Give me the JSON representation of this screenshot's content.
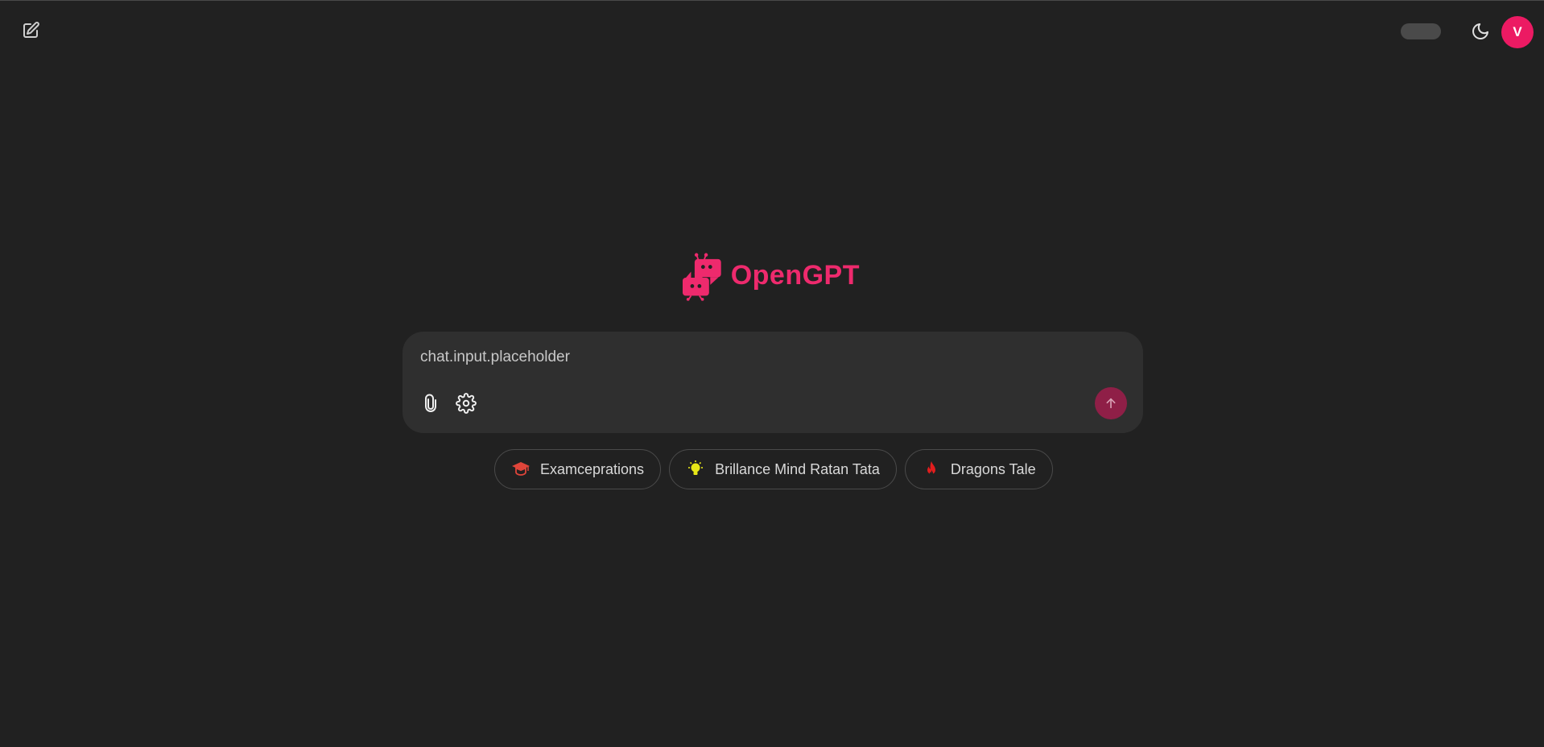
{
  "header": {
    "new_chat_icon": "edit-icon",
    "theme_icon": "moon-icon",
    "avatar_initial": "V",
    "avatar_color": "#ec1a63"
  },
  "logo": {
    "text": "OpenGPT",
    "color": "#ee2a6d",
    "icon": "robots-logo-icon"
  },
  "chat": {
    "placeholder": "chat.input.placeholder",
    "attach_icon": "paperclip-icon",
    "settings_icon": "gear-icon",
    "send_icon": "arrow-up-icon",
    "send_color": "#8f1f47"
  },
  "suggestions": [
    {
      "label": "Examceprations",
      "icon": "graduation-cap-icon"
    },
    {
      "label": "Brillance Mind Ratan Tata",
      "icon": "lightbulb-icon"
    },
    {
      "label": "Dragons Tale",
      "icon": "fire-icon"
    }
  ]
}
